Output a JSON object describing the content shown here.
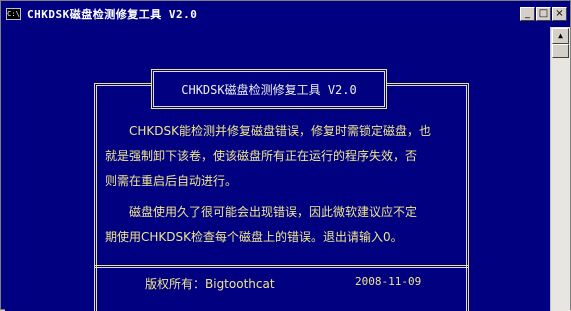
{
  "window": {
    "title": "CHKDSK磁盘检测修复工具 V2.0",
    "app_icon": "C:\\"
  },
  "title_buttons": {
    "minimize": "_",
    "maximize": "□",
    "close": "×"
  },
  "box_title": "CHKDSK磁盘检测修复工具 V2.0",
  "paragraph1": {
    "line1": "CHKDSK能检测并修复磁盘错误，修复时需锁定磁盘，也",
    "line2": "就是强制卸下该卷，使该磁盘所有正在运行的程序失效，否",
    "line3": "则需在重启后自动进行。"
  },
  "paragraph2": {
    "line1": "磁盘使用久了很可能会出现错误，因此微软建议应不定",
    "line2": "期使用CHKDSK检查每个磁盘上的错误。退出请输入0。"
  },
  "footer": {
    "copyright": "版权所有：Bigtoothcat",
    "date": "2008-11-09"
  },
  "scrollbar": {
    "up_arrow": "▲"
  },
  "colors": {
    "background": "#000080",
    "text": "#f0e68c",
    "frame": "#e8e0a0"
  }
}
